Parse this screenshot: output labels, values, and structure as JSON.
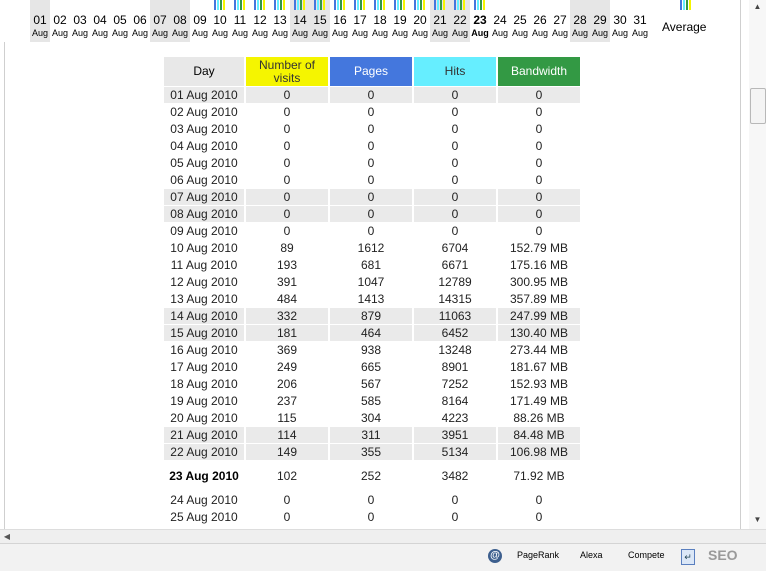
{
  "colors": {
    "visits_header": "#f5f500",
    "pages_header": "#4477dd",
    "hits_header": "#66eeff",
    "bandwidth_header": "#339944",
    "weekend_row": "#eaeaea"
  },
  "day_strip": {
    "days": [
      "01",
      "02",
      "03",
      "04",
      "05",
      "06",
      "07",
      "08",
      "09",
      "10",
      "11",
      "12",
      "13",
      "14",
      "15",
      "16",
      "17",
      "18",
      "19",
      "20",
      "21",
      "22",
      "23",
      "24",
      "25",
      "26",
      "27",
      "28",
      "29",
      "30",
      "31"
    ],
    "month": "Aug",
    "weekend_days": [
      "01",
      "07",
      "08",
      "14",
      "15",
      "21",
      "22",
      "28",
      "29"
    ],
    "today": "23",
    "days_with_data": [
      "10",
      "11",
      "12",
      "13",
      "14",
      "15",
      "16",
      "17",
      "18",
      "19",
      "20",
      "21",
      "22",
      "23"
    ],
    "average_label": "Average"
  },
  "table": {
    "headers": {
      "day": "Day",
      "visits": "Number of visits",
      "pages": "Pages",
      "hits": "Hits",
      "bandwidth": "Bandwidth"
    },
    "rows": [
      {
        "day": "01 Aug 2010",
        "visits": "0",
        "pages": "0",
        "hits": "0",
        "bandwidth": "0",
        "weekend": true
      },
      {
        "day": "02 Aug 2010",
        "visits": "0",
        "pages": "0",
        "hits": "0",
        "bandwidth": "0",
        "weekend": false
      },
      {
        "day": "03 Aug 2010",
        "visits": "0",
        "pages": "0",
        "hits": "0",
        "bandwidth": "0",
        "weekend": false
      },
      {
        "day": "04 Aug 2010",
        "visits": "0",
        "pages": "0",
        "hits": "0",
        "bandwidth": "0",
        "weekend": false
      },
      {
        "day": "05 Aug 2010",
        "visits": "0",
        "pages": "0",
        "hits": "0",
        "bandwidth": "0",
        "weekend": false
      },
      {
        "day": "06 Aug 2010",
        "visits": "0",
        "pages": "0",
        "hits": "0",
        "bandwidth": "0",
        "weekend": false
      },
      {
        "day": "07 Aug 2010",
        "visits": "0",
        "pages": "0",
        "hits": "0",
        "bandwidth": "0",
        "weekend": true
      },
      {
        "day": "08 Aug 2010",
        "visits": "0",
        "pages": "0",
        "hits": "0",
        "bandwidth": "0",
        "weekend": true
      },
      {
        "day": "09 Aug 2010",
        "visits": "0",
        "pages": "0",
        "hits": "0",
        "bandwidth": "0",
        "weekend": false
      },
      {
        "day": "10 Aug 2010",
        "visits": "89",
        "pages": "1612",
        "hits": "6704",
        "bandwidth": "152.79 MB",
        "weekend": false
      },
      {
        "day": "11 Aug 2010",
        "visits": "193",
        "pages": "681",
        "hits": "6671",
        "bandwidth": "175.16 MB",
        "weekend": false
      },
      {
        "day": "12 Aug 2010",
        "visits": "391",
        "pages": "1047",
        "hits": "12789",
        "bandwidth": "300.95 MB",
        "weekend": false
      },
      {
        "day": "13 Aug 2010",
        "visits": "484",
        "pages": "1413",
        "hits": "14315",
        "bandwidth": "357.89 MB",
        "weekend": false
      },
      {
        "day": "14 Aug 2010",
        "visits": "332",
        "pages": "879",
        "hits": "11063",
        "bandwidth": "247.99 MB",
        "weekend": true
      },
      {
        "day": "15 Aug 2010",
        "visits": "181",
        "pages": "464",
        "hits": "6452",
        "bandwidth": "130.40 MB",
        "weekend": true
      },
      {
        "day": "16 Aug 2010",
        "visits": "369",
        "pages": "938",
        "hits": "13248",
        "bandwidth": "273.44 MB",
        "weekend": false
      },
      {
        "day": "17 Aug 2010",
        "visits": "249",
        "pages": "665",
        "hits": "8901",
        "bandwidth": "181.67 MB",
        "weekend": false
      },
      {
        "day": "18 Aug 2010",
        "visits": "206",
        "pages": "567",
        "hits": "7252",
        "bandwidth": "152.93 MB",
        "weekend": false
      },
      {
        "day": "19 Aug 2010",
        "visits": "237",
        "pages": "585",
        "hits": "8164",
        "bandwidth": "171.49 MB",
        "weekend": false
      },
      {
        "day": "20 Aug 2010",
        "visits": "115",
        "pages": "304",
        "hits": "4223",
        "bandwidth": "88.26 MB",
        "weekend": false
      },
      {
        "day": "21 Aug 2010",
        "visits": "114",
        "pages": "311",
        "hits": "3951",
        "bandwidth": "84.48 MB",
        "weekend": true
      },
      {
        "day": "22 Aug 2010",
        "visits": "149",
        "pages": "355",
        "hits": "5134",
        "bandwidth": "106.98 MB",
        "weekend": true
      },
      {
        "day": "23 Aug 2010",
        "visits": "102",
        "pages": "252",
        "hits": "3482",
        "bandwidth": "71.92 MB",
        "weekend": false,
        "today": true
      },
      {
        "day": "24 Aug 2010",
        "visits": "0",
        "pages": "0",
        "hits": "0",
        "bandwidth": "0",
        "weekend": false
      },
      {
        "day": "25 Aug 2010",
        "visits": "0",
        "pages": "0",
        "hits": "0",
        "bandwidth": "0",
        "weekend": false
      }
    ]
  },
  "statusbar": {
    "pagerank": "PageRank",
    "alexa": "Alexa",
    "compete": "Compete",
    "seo": "SEO"
  }
}
